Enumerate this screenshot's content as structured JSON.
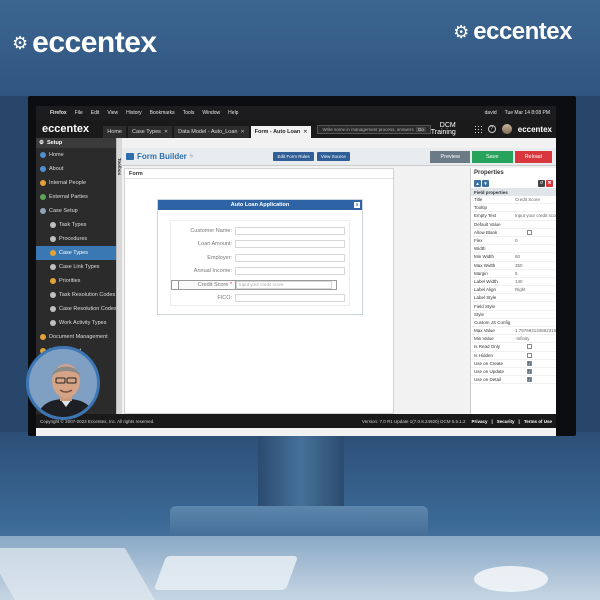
{
  "brand": {
    "name": "eccentex"
  },
  "os_menu": [
    "Firefox",
    "File",
    "Edit",
    "View",
    "History",
    "Bookmarks",
    "Tools",
    "Window",
    "Help"
  ],
  "os_clock": "Tue Mar 14  8:08 PM",
  "app": {
    "logo": "eccentex",
    "tabs": [
      {
        "label": "Home",
        "active": false
      },
      {
        "label": "Case Types",
        "active": false
      },
      {
        "label": "Data Model - Auto_Loan",
        "active": false
      },
      {
        "label": "Form - Auto Loan",
        "active": true
      }
    ],
    "status_pill": "Write some in management process, answers",
    "status_pill_btn": "Go",
    "title": "DCM Training",
    "user": "david"
  },
  "sidebar": {
    "header": "Setup",
    "items": [
      {
        "label": "Home",
        "color": "#4f8fcf",
        "indent": 0,
        "active": false
      },
      {
        "label": "About",
        "color": "#4f8fcf",
        "indent": 0,
        "active": false
      },
      {
        "label": "Internal People",
        "color": "#e0a33a",
        "indent": 0,
        "active": false
      },
      {
        "label": "External Parties",
        "color": "#5aa55a",
        "indent": 0,
        "active": false
      },
      {
        "label": "Case Setup",
        "color": "#8fa4b8",
        "indent": 0,
        "active": false
      },
      {
        "label": "Task Types",
        "color": "#c0c0c0",
        "indent": 1,
        "active": false
      },
      {
        "label": "Procedures",
        "color": "#c0c0c0",
        "indent": 1,
        "active": false
      },
      {
        "label": "Case Types",
        "color": "#e0a33a",
        "indent": 1,
        "active": true
      },
      {
        "label": "Case Link Types",
        "color": "#c0c0c0",
        "indent": 1,
        "active": false
      },
      {
        "label": "Priorities",
        "color": "#e0a33a",
        "indent": 1,
        "active": false
      },
      {
        "label": "Task Resolution Codes",
        "color": "#c0c0c0",
        "indent": 1,
        "active": false
      },
      {
        "label": "Case Resolution Codes",
        "color": "#c0c0c0",
        "indent": 1,
        "active": false
      },
      {
        "label": "Work Activity Types",
        "color": "#c0c0c0",
        "indent": 1,
        "active": false
      },
      {
        "label": "Document Management",
        "color": "#e0a33a",
        "indent": 0,
        "active": false
      },
      {
        "label": "Management",
        "color": "#e0a33a",
        "indent": 0,
        "active": false
      }
    ]
  },
  "toolbox_label": "Toolbox",
  "form_builder": {
    "title": "Form Builder",
    "btn_edit_rules": "Edit Form Rules",
    "btn_view_source": "View Source",
    "btn_preview": "Preview",
    "btn_save": "Save",
    "btn_reload": "Reload"
  },
  "form": {
    "caption": "Form",
    "card_title": "Auto Loan Application",
    "fields": [
      {
        "label": "Customer Name:",
        "placeholder": "",
        "selected": false
      },
      {
        "label": "Loan Amount:",
        "placeholder": "",
        "selected": false
      },
      {
        "label": "Employer:",
        "placeholder": "",
        "selected": false
      },
      {
        "label": "Annual Income:",
        "placeholder": "",
        "selected": false
      },
      {
        "label": "Credit Score",
        "placeholder": "Input your credit score",
        "selected": true,
        "required": "*"
      },
      {
        "label": "FICO:",
        "placeholder": "",
        "selected": false
      }
    ]
  },
  "properties": {
    "header": "Properties",
    "section": "Field properties",
    "rows": [
      {
        "key": "Title",
        "value": "Credit Score"
      },
      {
        "key": "Tooltip",
        "value": ""
      },
      {
        "key": "Empty Text",
        "value": "Input your credit score"
      },
      {
        "key": "Default Value",
        "value": ""
      },
      {
        "key": "Allow Blank",
        "check": false
      },
      {
        "key": "Flex",
        "value": "0"
      },
      {
        "key": "Width",
        "value": ""
      },
      {
        "key": "Min Width",
        "value": "50"
      },
      {
        "key": "Max Width",
        "value": "350"
      },
      {
        "key": "Margin",
        "value": "5"
      },
      {
        "key": "Label Width",
        "value": "140"
      },
      {
        "key": "Label Align",
        "value": "Right"
      },
      {
        "key": "Label Style",
        "value": ""
      },
      {
        "key": "Field Style",
        "value": ""
      },
      {
        "key": "Style",
        "value": ""
      },
      {
        "key": "Custom JS Config",
        "value": ""
      },
      {
        "key": "Max Value",
        "value": "1.7976931348623157e..."
      },
      {
        "key": "Min Value",
        "value": "-Infinity"
      },
      {
        "key": "Is Read Only",
        "check": false
      },
      {
        "key": "Is Hidden",
        "check": false
      },
      {
        "key": "Use on Create",
        "check": true
      },
      {
        "key": "Use on Update",
        "check": true
      },
      {
        "key": "Use on Detail",
        "check": true
      }
    ]
  },
  "footer": {
    "copyright": "Copyright © 2007-2023 Eccentex, Inc. All rights reserved.",
    "version": "Version:  7.0 R1 Update 1(7.0.8.24920)  DCM 5.5.1.2",
    "links": [
      "Privacy",
      "Security",
      "Terms of Use"
    ]
  }
}
